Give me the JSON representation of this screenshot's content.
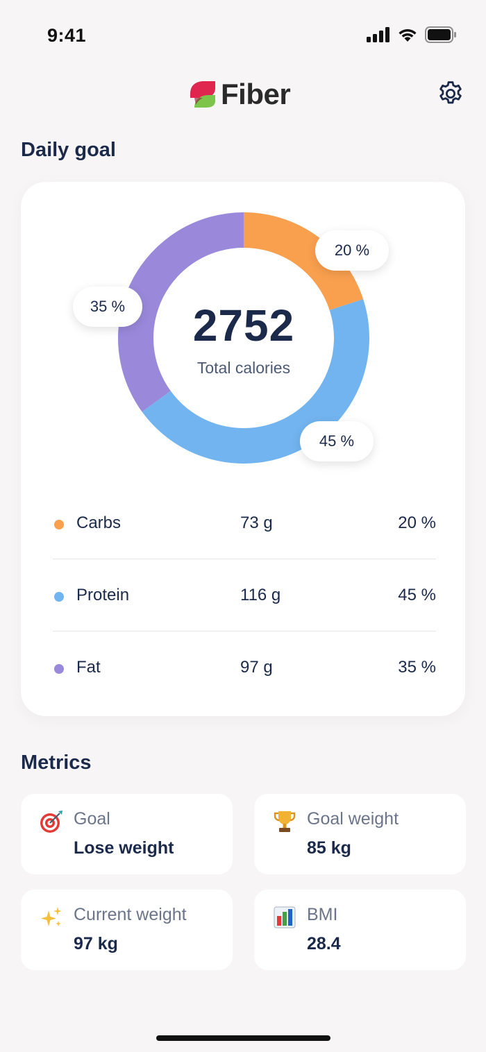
{
  "status_bar": {
    "time": "9:41"
  },
  "header": {
    "app_name": "Fiber"
  },
  "daily_goal": {
    "title": "Daily goal",
    "total_calories": "2752",
    "total_label": "Total calories",
    "pill_carbs": "20 %",
    "pill_protein": "45 %",
    "pill_fat": "35 %",
    "macros": [
      {
        "name": "Carbs",
        "grams": "73 g",
        "percent": "20 %",
        "color": "#f9a04f"
      },
      {
        "name": "Protein",
        "grams": "116 g",
        "percent": "45 %",
        "color": "#72b4ef"
      },
      {
        "name": "Fat",
        "grams": "97 g",
        "percent": "35 %",
        "color": "#9a88da"
      }
    ]
  },
  "chart_data": {
    "type": "pie",
    "categories": [
      "Carbs",
      "Protein",
      "Fat"
    ],
    "values": [
      20,
      45,
      35
    ],
    "colors": [
      "#f9a04f",
      "#72b4ef",
      "#9a88da"
    ]
  },
  "metrics": {
    "title": "Metrics",
    "items": [
      {
        "icon": "target-icon",
        "label": "Goal",
        "value": "Lose weight"
      },
      {
        "icon": "trophy-icon",
        "label": "Goal weight",
        "value": "85 kg"
      },
      {
        "icon": "sparkles-icon",
        "label": "Current weight",
        "value": "97 kg"
      },
      {
        "icon": "bar-chart-icon",
        "label": "BMI",
        "value": "28.4"
      }
    ]
  }
}
